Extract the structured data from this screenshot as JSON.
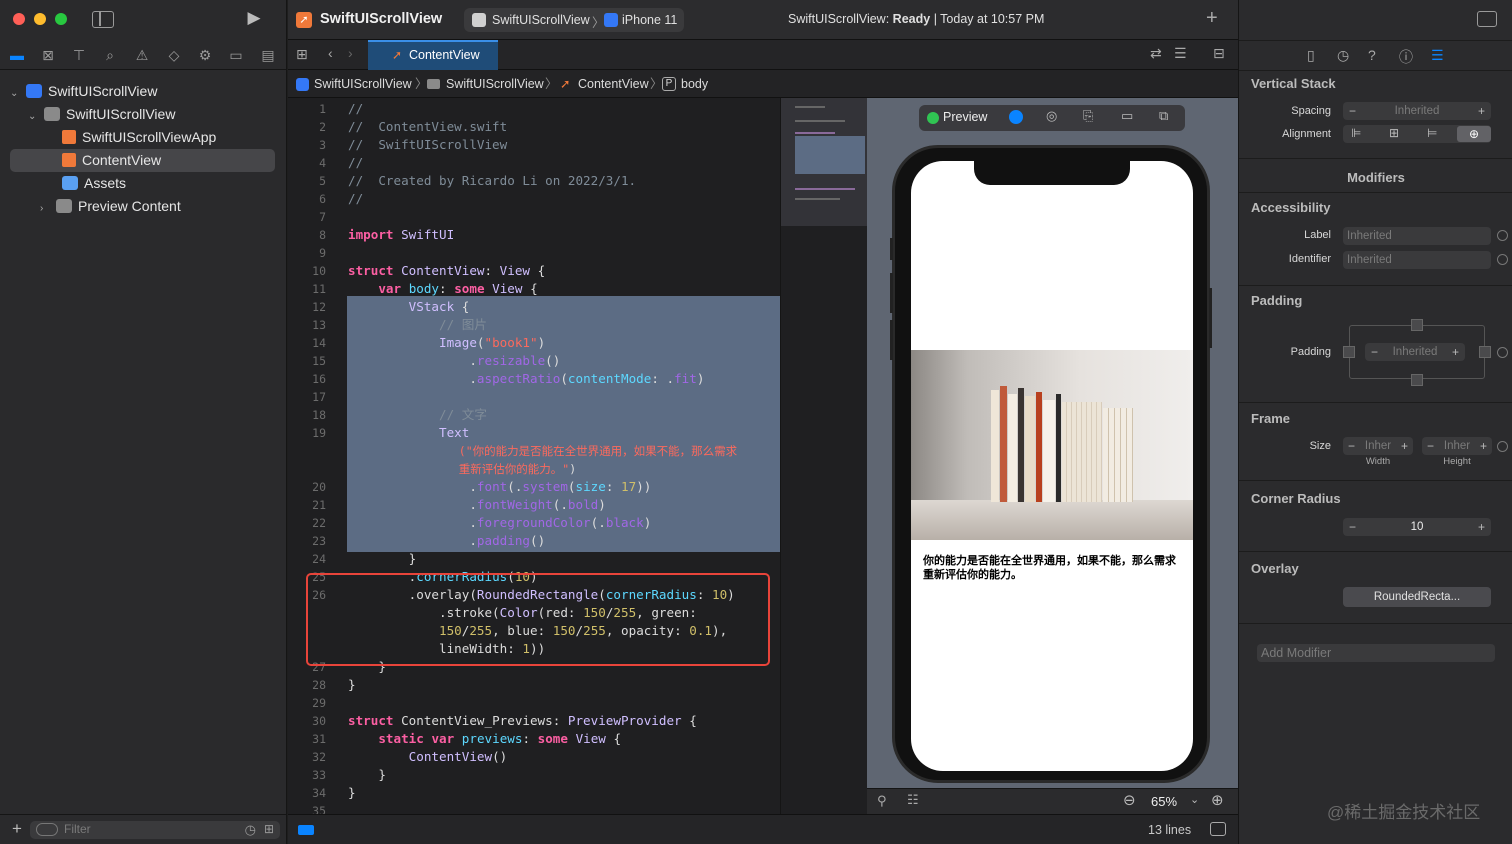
{
  "window": {
    "scheme_name": "SwiftUIScrollView",
    "destination_project": "SwiftUIScrollView",
    "destination_device": "iPhone 11",
    "status_project": "SwiftUIScrollView:",
    "status_state": "Ready",
    "status_time": "| Today at 10:57 PM"
  },
  "navigator": {
    "items": [
      {
        "label": "SwiftUIScrollView",
        "icon": "project-icon",
        "expanded": true
      },
      {
        "label": "SwiftUIScrollView",
        "icon": "folder-icon",
        "expanded": true
      },
      {
        "label": "SwiftUIScrollViewApp",
        "icon": "swift-file-icon"
      },
      {
        "label": "ContentView",
        "icon": "swift-file-icon",
        "selected": true
      },
      {
        "label": "Assets",
        "icon": "asset-catalog-icon"
      },
      {
        "label": "Preview Content",
        "icon": "folder-icon",
        "expanded": false
      }
    ],
    "filter_placeholder": "Filter"
  },
  "editor": {
    "tab_label": "ContentView",
    "breadcrumb": [
      "SwiftUIScrollView",
      "SwiftUIScrollView",
      "ContentView",
      "body"
    ],
    "line_count": "13 lines",
    "lines": [
      {
        "n": "1",
        "t": "//"
      },
      {
        "n": "2",
        "t": "//  ContentView.swift"
      },
      {
        "n": "3",
        "t": "//  SwiftUIScrollView"
      },
      {
        "n": "4",
        "t": "//"
      },
      {
        "n": "5",
        "t": "//  Created by Ricardo Li on 2022/3/1."
      },
      {
        "n": "6",
        "t": "//"
      },
      {
        "n": "7",
        "t": ""
      },
      {
        "n": "8",
        "t": "import SwiftUI"
      },
      {
        "n": "9",
        "t": ""
      },
      {
        "n": "10",
        "t": "struct ContentView: View {"
      },
      {
        "n": "11",
        "t": "    var body: some View {"
      },
      {
        "n": "12",
        "t": "        VStack {"
      },
      {
        "n": "13",
        "t": "            // 图片"
      },
      {
        "n": "14",
        "t": "            Image(\"book1\")"
      },
      {
        "n": "15",
        "t": "                .resizable()"
      },
      {
        "n": "16",
        "t": "                .aspectRatio(contentMode: .fit)"
      },
      {
        "n": "17",
        "t": ""
      },
      {
        "n": "18",
        "t": "            // 文字"
      },
      {
        "n": "19",
        "t": "            Text"
      },
      {
        "n": "",
        "t": "                (\"你的能力是否能在全世界通用，如果不能，那么需求"
      },
      {
        "n": "",
        "t": "                重新评估你的能力。\")"
      },
      {
        "n": "20",
        "t": "                .font(.system(size: 17))"
      },
      {
        "n": "21",
        "t": "                .fontWeight(.bold)"
      },
      {
        "n": "22",
        "t": "                .foregroundColor(.black)"
      },
      {
        "n": "23",
        "t": "                .padding()"
      },
      {
        "n": "24",
        "t": "        }"
      },
      {
        "n": "25",
        "t": "        .cornerRadius(10)"
      },
      {
        "n": "26",
        "t": "        .overlay(RoundedRectangle(cornerRadius: 10)"
      },
      {
        "n": "",
        "t": "            .stroke(Color(red: 150/255, green:"
      },
      {
        "n": "",
        "t": "            150/255, blue: 150/255, opacity: 0.1),"
      },
      {
        "n": "",
        "t": "            lineWidth: 1))"
      },
      {
        "n": "27",
        "t": "    }"
      },
      {
        "n": "28",
        "t": "}"
      },
      {
        "n": "29",
        "t": ""
      },
      {
        "n": "30",
        "t": "struct ContentView_Previews: PreviewProvider {"
      },
      {
        "n": "31",
        "t": "    static var previews: some View {"
      },
      {
        "n": "32",
        "t": "        ContentView()"
      },
      {
        "n": "33",
        "t": "    }"
      },
      {
        "n": "34",
        "t": "}"
      },
      {
        "n": "35",
        "t": ""
      }
    ]
  },
  "preview": {
    "preview_label": "Preview",
    "text": "你的能力是否能在全世界通用，如果不能，那么需求重新评估你的能力。",
    "zoom": "65%"
  },
  "inspector": {
    "vstack_title": "Vertical Stack",
    "spacing_label": "Spacing",
    "spacing_value": "Inherited",
    "alignment_label": "Alignment",
    "modifiers_title": "Modifiers",
    "accessibility_title": "Accessibility",
    "label_label": "Label",
    "label_value": "Inherited",
    "identifier_label": "Identifier",
    "identifier_value": "Inherited",
    "padding_title": "Padding",
    "padding_label": "Padding",
    "padding_value": "Inherited",
    "frame_title": "Frame",
    "size_label": "Size",
    "width_value": "Inher",
    "height_value": "Inher",
    "width_label": "Width",
    "height_label": "Height",
    "corner_title": "Corner Radius",
    "corner_value": "10",
    "overlay_title": "Overlay",
    "overlay_value": "RoundedRecta...",
    "add_modifier_placeholder": "Add Modifier"
  },
  "watermark": "@稀土掘金技术社区",
  "colors": {
    "accent": "#0a84ff",
    "highlight": "#e8443a",
    "swift": "#f0793a"
  }
}
